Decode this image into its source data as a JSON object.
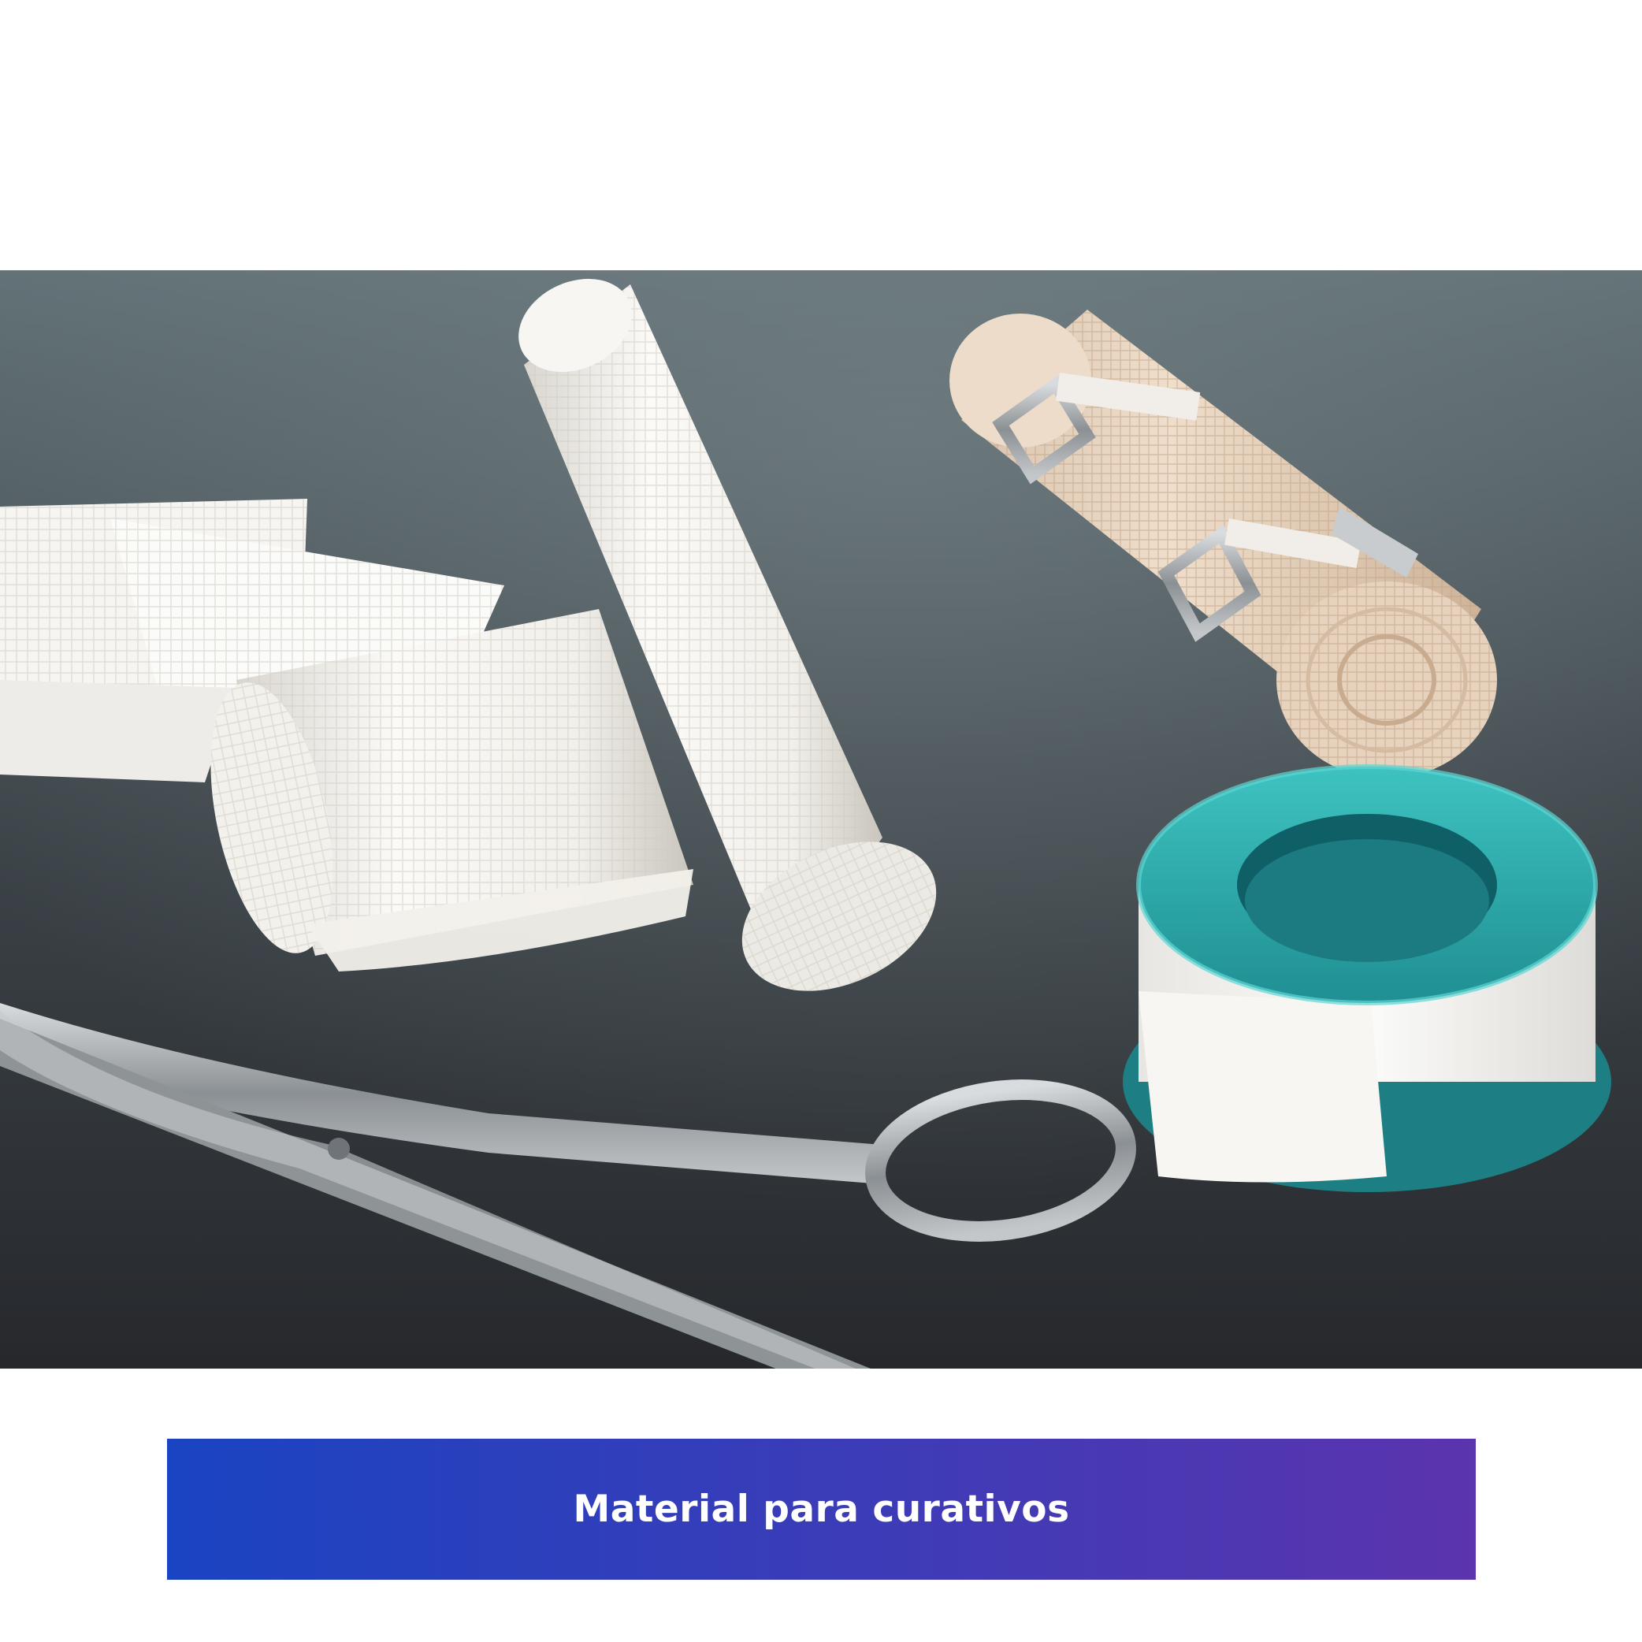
{
  "photo": {
    "subject": "photo-bandages-gauze-scissors-tape",
    "colors": {
      "surface_top": "#5f6f74",
      "surface_bottom": "#2a2c30",
      "gauze": "#f4f2ee",
      "crepe_bandage": "#e9d7c4",
      "tape_spool": "#29a8a8",
      "metal": "#b9bcbf"
    }
  },
  "caption": {
    "text": "Material para curativos",
    "colors": {
      "gradient_start": "#1a44c2",
      "gradient_end": "#5b34ae",
      "text": "#ffffff"
    }
  }
}
